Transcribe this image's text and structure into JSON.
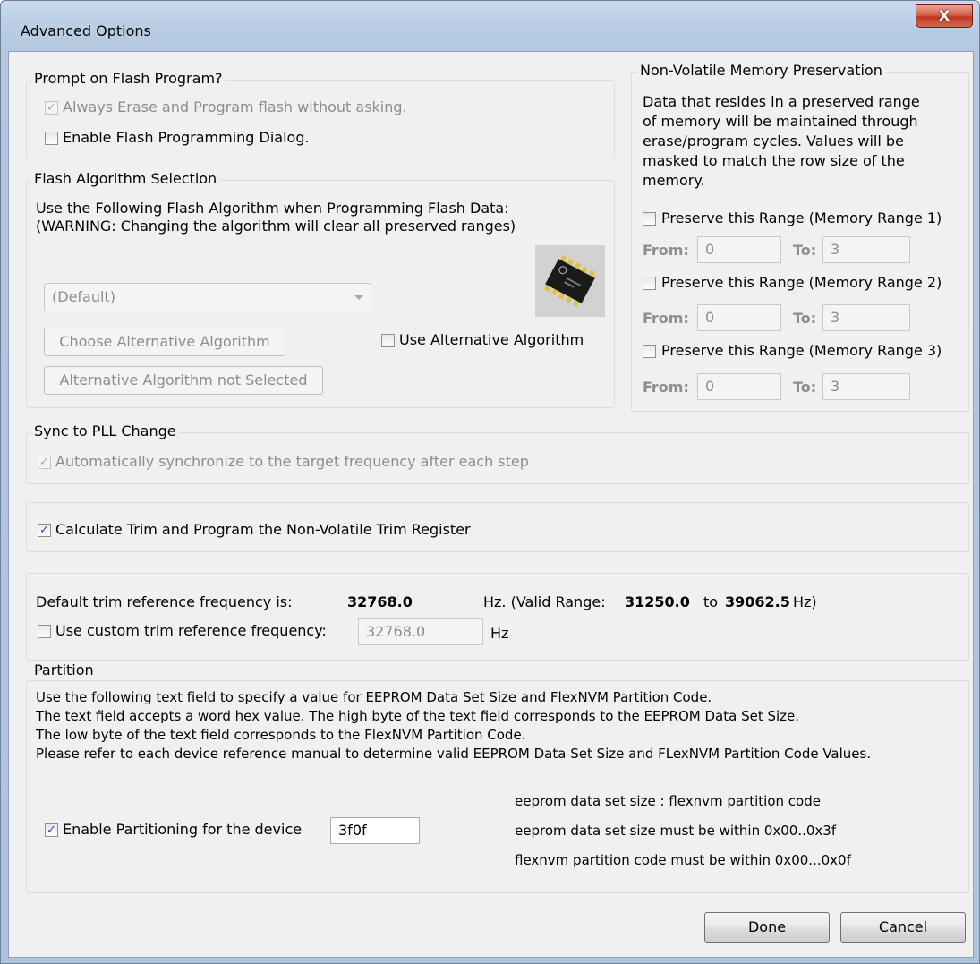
{
  "window": {
    "title": "Advanced Options",
    "close_glyph": "X"
  },
  "prompt_group": {
    "label": "Prompt on Flash Program?",
    "always_erase": {
      "label": "Always Erase and Program flash without asking.",
      "check": "✓"
    },
    "enable_dialog": {
      "label": "Enable Flash Programming Dialog.",
      "check": ""
    }
  },
  "algorithm_group": {
    "label": "Flash Algorithm Selection",
    "line1": "Use the Following Flash Algorithm when Programming Flash Data:",
    "line2": "(WARNING: Changing the algorithm will clear all preserved ranges)",
    "selected_value": "(Default)",
    "choose_button": "Choose Alternative Algorithm",
    "not_selected_button": "Alternative Algorithm not Selected",
    "use_alt": {
      "label": "Use Alternative Algorithm",
      "check": ""
    },
    "chip_icon": "chip-icon"
  },
  "nvm_group": {
    "label": "Non-Volatile Memory Preservation",
    "desc": [
      "Data that resides in a preserved range",
      "of memory will be maintained through",
      "erase/program cycles. Values will be",
      "masked to match the row size of the",
      "memory."
    ],
    "from_label": "From:",
    "to_label": "To:",
    "ranges": [
      {
        "label": "Preserve this Range (Memory Range 1)",
        "check": "",
        "from": "0",
        "to": "3"
      },
      {
        "label": "Preserve this Range (Memory Range 2)",
        "check": "",
        "from": "0",
        "to": "3"
      },
      {
        "label": "Preserve this Range (Memory Range 3)",
        "check": "",
        "from": "0",
        "to": "3"
      }
    ]
  },
  "sync_group": {
    "label": "Sync to PLL Change",
    "auto_sync": {
      "label": "Automatically synchronize to the target frequency after each step",
      "check": "✓"
    }
  },
  "trim_group": {
    "calc": {
      "label": "Calculate Trim and Program the Non-Volatile Trim Register",
      "check": "✓"
    }
  },
  "freq_group": {
    "default_label": "Default trim reference frequency is:",
    "default_value": "32768.0",
    "hz_valid_prefix": "Hz. (Valid Range:",
    "range_min": "31250.0",
    "to_word": "to",
    "range_max": "39062.5",
    "hz_suffix": "Hz)",
    "custom": {
      "label": "Use custom trim reference frequency:",
      "check": ""
    },
    "custom_value": "32768.0",
    "custom_unit": "Hz"
  },
  "partition_group": {
    "label": "Partition",
    "lines": [
      "Use the following text field to specify a value for EEPROM Data Set Size and FlexNVM Partition Code.",
      "The text field accepts a word hex value. The high byte of the text field corresponds to the EEPROM Data Set Size.",
      "The low byte of the text field corresponds to the FlexNVM Partition Code.",
      "Please refer to each device reference manual to determine valid EEPROM Data Set Size and FLexNVM Partition Code Values."
    ],
    "enable": {
      "label": "Enable Partitioning for the device",
      "check": "✓"
    },
    "value": "3f0f",
    "hints": [
      "eeprom data set size : flexnvm partition code",
      "eeprom data set size must be within 0x00..0x3f",
      "flexnvm partition code must be within 0x00...0x0f"
    ]
  },
  "buttons": {
    "done": "Done",
    "cancel": "Cancel"
  }
}
